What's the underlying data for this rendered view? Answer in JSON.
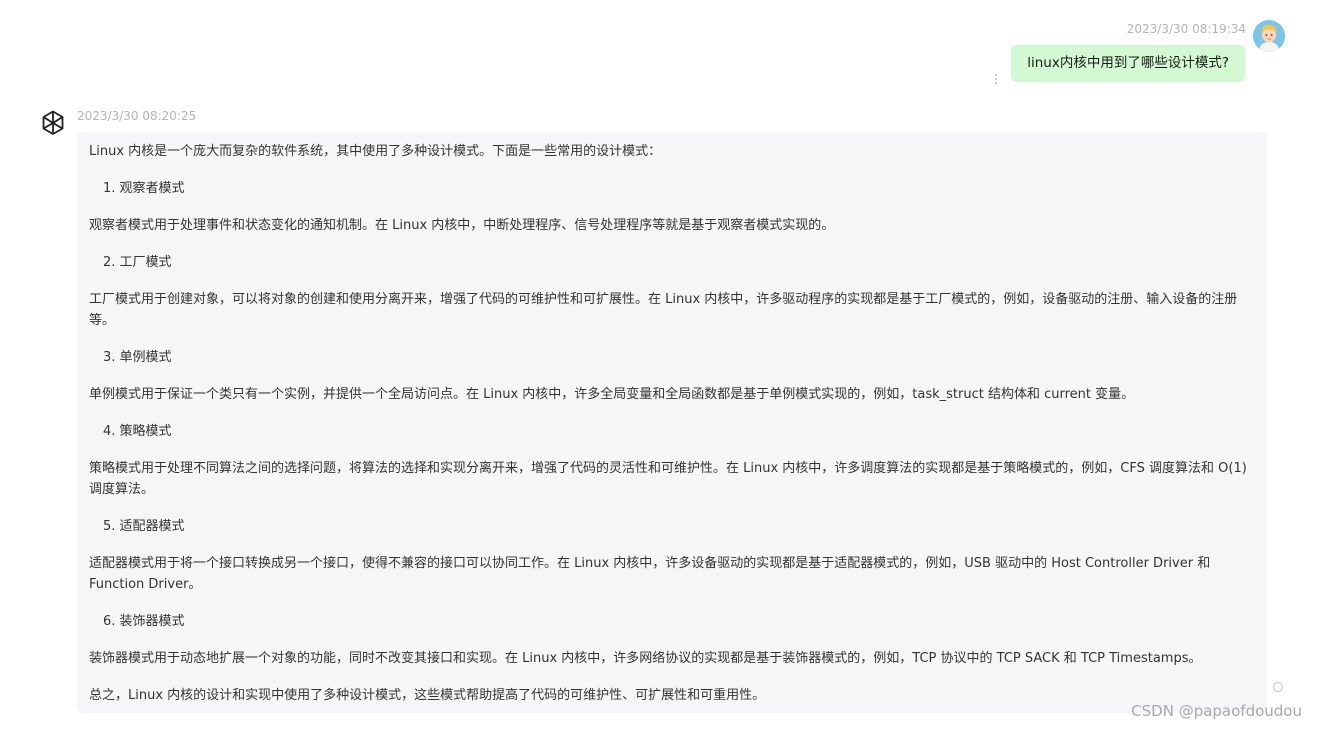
{
  "user_message": {
    "timestamp": "2023/3/30 08:19:34",
    "text": "linux内核中用到了哪些设计模式?",
    "avatar_icon": "user-avatar-cartoon-icon"
  },
  "bot_message": {
    "timestamp": "2023/3/30 08:20:25",
    "logo_icon": "openai-logo-icon",
    "paragraphs": {
      "intro": "Linux 内核是一个庞大而复杂的软件系统，其中使用了多种设计模式。下面是一些常用的设计模式：",
      "h1": "1. 观察者模式",
      "p1": "观察者模式用于处理事件和状态变化的通知机制。在 Linux 内核中，中断处理程序、信号处理程序等就是基于观察者模式实现的。",
      "h2": "2. 工厂模式",
      "p2": "工厂模式用于创建对象，可以将对象的创建和使用分离开来，增强了代码的可维护性和可扩展性。在 Linux 内核中，许多驱动程序的实现都是基于工厂模式的，例如，设备驱动的注册、输入设备的注册等。",
      "h3": "3. 单例模式",
      "p3": "单例模式用于保证一个类只有一个实例，并提供一个全局访问点。在 Linux 内核中，许多全局变量和全局函数都是基于单例模式实现的，例如，task_struct 结构体和 current 变量。",
      "h4": "4. 策略模式",
      "p4": "策略模式用于处理不同算法之间的选择问题，将算法的选择和实现分离开来，增强了代码的灵活性和可维护性。在 Linux 内核中，许多调度算法的实现都是基于策略模式的，例如，CFS 调度算法和 O(1) 调度算法。",
      "h5": "5. 适配器模式",
      "p5": "适配器模式用于将一个接口转换成另一个接口，使得不兼容的接口可以协同工作。在 Linux 内核中，许多设备驱动的实现都是基于适配器模式的，例如，USB 驱动中的 Host Controller Driver 和 Function Driver。",
      "h6": "6. 装饰器模式",
      "p6": "装饰器模式用于动态地扩展一个对象的功能，同时不改变其接口和实现。在 Linux 内核中，许多网络协议的实现都是基于装饰器模式的，例如，TCP 协议中的 TCP SACK 和 TCP Timestamps。",
      "conclusion": "总之，Linux 内核的设计和实现中使用了多种设计模式，这些模式帮助提高了代码的可维护性、可扩展性和可重用性。"
    }
  },
  "watermark": "CSDN @papaofdoudou",
  "icons": {
    "more": "vertical-dots-icon",
    "loading": "loading-circle-icon"
  },
  "colors": {
    "user_bubble": "#d2f9d1",
    "bot_bubble": "#f4f6f8",
    "timestamp": "#b4b4b4"
  }
}
